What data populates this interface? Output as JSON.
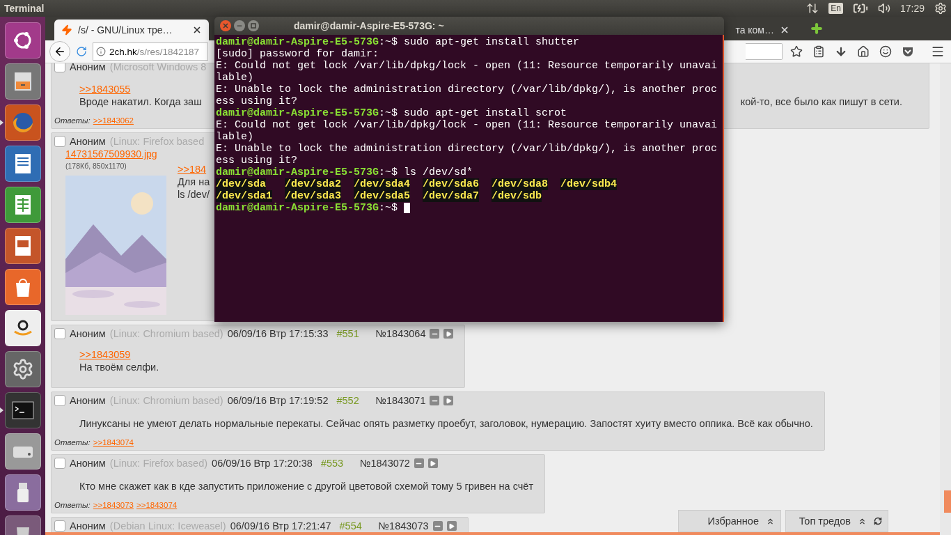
{
  "top_panel": {
    "app_title": "Terminal",
    "keyboard": "En",
    "clock": "17:29"
  },
  "launcher": [
    {
      "kind": "ubuntu",
      "running": false
    },
    {
      "kind": "files",
      "running": false
    },
    {
      "kind": "firefox",
      "running": true
    },
    {
      "kind": "writer",
      "running": false
    },
    {
      "kind": "calc",
      "running": false
    },
    {
      "kind": "impress",
      "running": false
    },
    {
      "kind": "software",
      "running": false
    },
    {
      "kind": "amazon",
      "running": false
    },
    {
      "kind": "settings",
      "running": false
    },
    {
      "kind": "terminal",
      "running": true
    },
    {
      "kind": "disk",
      "running": false
    },
    {
      "kind": "usb",
      "running": false
    },
    {
      "kind": "trash",
      "running": false
    }
  ],
  "browser": {
    "tabs": [
      {
        "title": "/s/ - GNU/Linux тре…",
        "selected": true
      },
      {
        "title": "та ком…",
        "selected": false
      }
    ],
    "address": {
      "host": "2ch.hk",
      "path": "/s/res/1842187"
    },
    "posts": [
      {
        "kind": "split",
        "checked": false,
        "author": "Аноним",
        "agent": "(Microsoft Windows 8",
        "ref": ">>1843055",
        "text": "Вроде накатил. Когда заш",
        "text_right": "кой-то, все было как пишут в сети.",
        "replies_label": "Ответы:",
        "replies": [
          ">>1843062"
        ]
      },
      {
        "kind": "file",
        "checked": false,
        "author": "Аноним",
        "agent": "(Linux: Firefox based",
        "file_name": "14731567509930.jpg",
        "file_info": "(178Кб, 850x1170)",
        "ref": ">>184",
        "lines": [
          "Для на",
          "ls /dev/"
        ]
      },
      {
        "kind": "plain",
        "checked": false,
        "author": "Аноним",
        "agent": "(Linux: Chromium based)",
        "date": "06/09/16 Втр 17:15:33",
        "num": "#551",
        "id": "№1843064",
        "ref": ">>1843059",
        "text": "На твоём селфи."
      },
      {
        "kind": "plain",
        "checked": false,
        "author": "Аноним",
        "agent": "(Linux: Chromium based)",
        "date": "06/09/16 Втр 17:19:52",
        "num": "#552",
        "id": "№1843071",
        "text": "Линуксаны не умеют делать нормальные перекаты. Сейчас опять разметку проебут, заголовок, нумерацию. Запостят хуиту вместо оппика. Всё как обычно.",
        "replies_label": "Ответы:",
        "replies": [
          ">>1843074"
        ]
      },
      {
        "kind": "plain",
        "checked": false,
        "author": "Аноним",
        "agent": "(Linux: Firefox based)",
        "date": "06/09/16 Втр 17:20:38",
        "num": "#553",
        "id": "№1843072",
        "text": "Кто мне скажет как в кде запустить приложение с другой цветовой схемой тому 5 гривен на счёт",
        "replies_label": "Ответы:",
        "replies": [
          ">>1843073",
          ">>1843074"
        ]
      },
      {
        "kind": "plain",
        "checked": false,
        "author": "Аноним",
        "agent": "(Debian Linux: Iceweasel)",
        "date": "06/09/16 Втр 17:21:47",
        "num": "#554",
        "id": "№1843073"
      }
    ],
    "panels": [
      {
        "label": "Избранное",
        "refresh": false
      },
      {
        "label": "Топ тредов",
        "refresh": true
      }
    ]
  },
  "terminal": {
    "title": "damir@damir-Aspire-E5-573G: ~",
    "lines": [
      {
        "kind": "prompt",
        "user": "damir@damir-Aspire-E5-573G",
        "tail": ":~$",
        "command": " sudo apt-get install shutter"
      },
      {
        "kind": "output",
        "text": "[sudo] password for damir:"
      },
      {
        "kind": "output",
        "text": "E: Could not get lock /var/lib/dpkg/lock - open (11: Resource temporarily unavai"
      },
      {
        "kind": "output",
        "text": "lable)"
      },
      {
        "kind": "output",
        "text": "E: Unable to lock the administration directory (/var/lib/dpkg/), is another proc"
      },
      {
        "kind": "output",
        "text": "ess using it?"
      },
      {
        "kind": "prompt",
        "user": "damir@damir-Aspire-E5-573G",
        "tail": ":~$",
        "command": " sudo apt-get install scrot"
      },
      {
        "kind": "output",
        "text": "E: Could not get lock /var/lib/dpkg/lock - open (11: Resource temporarily unavai"
      },
      {
        "kind": "output",
        "text": "lable)"
      },
      {
        "kind": "output",
        "text": "E: Unable to lock the administration directory (/var/lib/dpkg/), is another proc"
      },
      {
        "kind": "output",
        "text": "ess using it?"
      },
      {
        "kind": "prompt",
        "user": "damir@damir-Aspire-E5-573G",
        "tail": ":~$",
        "command": " ls /dev/sd*"
      },
      {
        "kind": "files",
        "items": [
          "/dev/sda",
          "/dev/sda2",
          "/dev/sda4",
          "/dev/sda6",
          "/dev/sda8",
          "/dev/sdb4"
        ]
      },
      {
        "kind": "files",
        "items": [
          "/dev/sda1",
          "/dev/sda3",
          "/dev/sda5",
          "/dev/sda7",
          "/dev/sdb"
        ]
      },
      {
        "kind": "prompt",
        "user": "damir@damir-Aspire-E5-573G",
        "tail": ":~$",
        "cursor": true
      }
    ]
  }
}
